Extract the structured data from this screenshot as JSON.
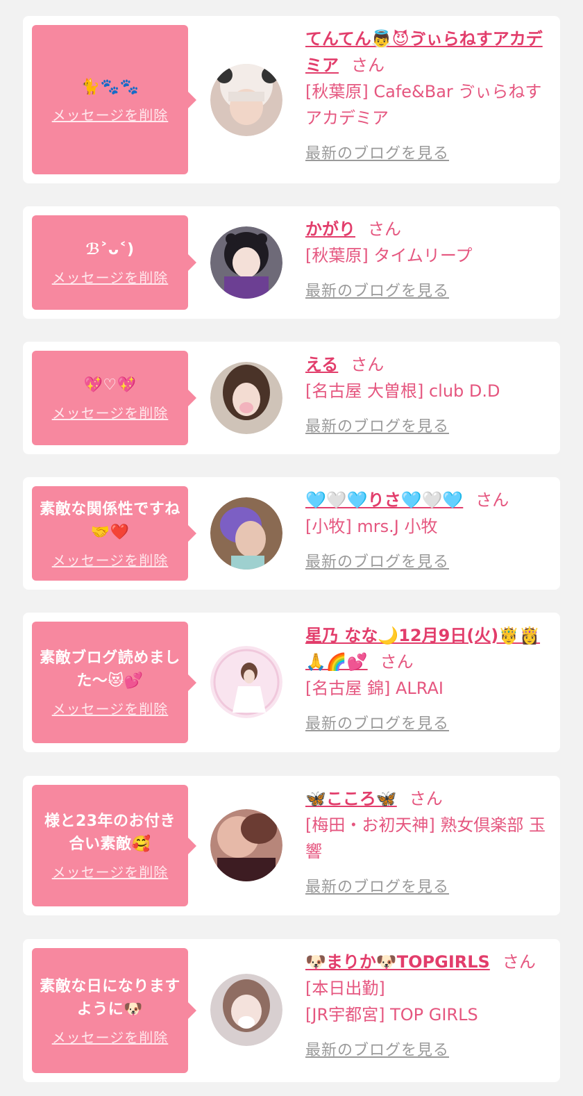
{
  "delete_label": "メッセージを削除",
  "blog_label": "最新のブログを見る",
  "san_label": "さん",
  "colors": {
    "bubble": "#f7889f",
    "accent": "#e23d6b",
    "muted": "#9a9a9a",
    "background": "#f2f2f2"
  },
  "items": [
    {
      "message": "🐈🐾🐾",
      "name": "てんてん👼😈ゔぃらねすアカデミア",
      "shop": "[秋葉原] Cafe&Bar ゔぃらねすアカデミア"
    },
    {
      "message": "ℬ˃ᴗ˂)",
      "name": "かがり",
      "shop": "[秋葉原] タイムリープ"
    },
    {
      "message": "💖♡💖",
      "name": "える",
      "shop": "[名古屋 大曽根] club D.D"
    },
    {
      "message": "素敵な関係性ですね🤝❤️",
      "name": "🩵🤍🩵りさ🩵🤍🩵",
      "shop": "[小牧] mrs.J 小牧"
    },
    {
      "message": "素敵ブログ読めました〜😻💕",
      "name": "星乃 なな🌙12月9日(火)🤴👸🙏🌈💕",
      "shop": "[名古屋 錦] ALRAI"
    },
    {
      "message": "様と23年のお付き合い素敵🥰",
      "name": "🦋こころ🦋",
      "shop": "[梅田・お初天神] 熟女倶楽部 玉響"
    },
    {
      "message": "素敵な日になりますように🐶",
      "name": "🐶まりか🐶TOPGIRLS",
      "extra": "[本日出勤]",
      "shop": "[JR宇都宮] TOP GIRLS"
    }
  ]
}
